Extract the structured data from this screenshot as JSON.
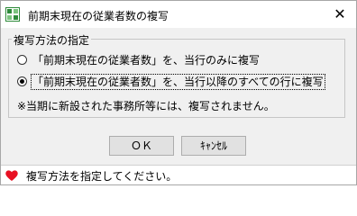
{
  "window": {
    "title": "前期末現在の従業者数の複写",
    "close_glyph": "✕"
  },
  "group": {
    "legend": "複写方法の指定",
    "options": [
      {
        "label": "「前期末現在の従業者数」を、当行のみに複写",
        "checked": false
      },
      {
        "label": "「前期末現在の従業者数」を、当行以降のすべての行に複写",
        "checked": true
      }
    ],
    "note": "※当期に新設された事務所等には、複写されません。"
  },
  "buttons": {
    "ok": "ＯＫ",
    "cancel": "ｷｬﾝｾﾙ"
  },
  "status": {
    "message": "複写方法を指定してください。"
  },
  "colors": {
    "heart": "#e81123",
    "icon_green": "#2e8b3a"
  }
}
